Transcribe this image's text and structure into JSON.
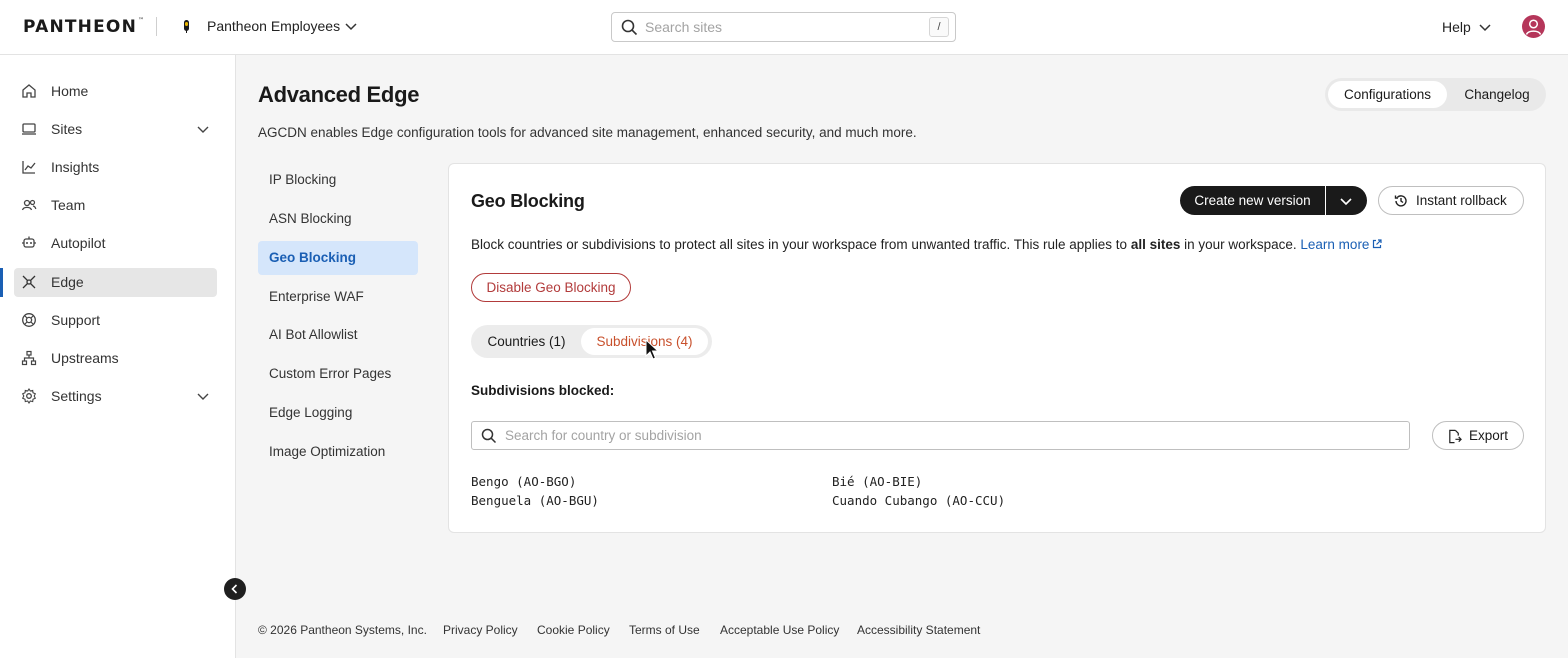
{
  "header": {
    "logo_text": "PANTHEON",
    "logo_mark": "™",
    "workspace_name": "Pantheon Employees",
    "search_placeholder": "Search sites",
    "search_shortcut": "/",
    "help_label": "Help",
    "colors": {
      "avatar": "#b5365a"
    }
  },
  "sidebar": {
    "items": [
      {
        "label": "Home",
        "icon": "home-icon"
      },
      {
        "label": "Sites",
        "icon": "sites-icon",
        "expandable": true
      },
      {
        "label": "Insights",
        "icon": "insights-icon"
      },
      {
        "label": "Team",
        "icon": "team-icon"
      },
      {
        "label": "Autopilot",
        "icon": "autopilot-icon"
      },
      {
        "label": "Edge",
        "icon": "edge-icon",
        "active": true
      },
      {
        "label": "Support",
        "icon": "support-icon"
      },
      {
        "label": "Upstreams",
        "icon": "upstreams-icon"
      },
      {
        "label": "Settings",
        "icon": "settings-icon",
        "expandable": true
      }
    ]
  },
  "main": {
    "title": "Advanced Edge",
    "description": "AGCDN enables Edge configuration tools for advanced site management, enhanced security, and much more.",
    "view_tabs": {
      "configurations": "Configurations",
      "changelog": "Changelog",
      "selected": "Configurations"
    },
    "subnav": [
      {
        "label": "IP Blocking"
      },
      {
        "label": "ASN Blocking"
      },
      {
        "label": "Geo Blocking",
        "active": true
      },
      {
        "label": "Enterprise WAF"
      },
      {
        "label": "AI Bot Allowlist"
      },
      {
        "label": "Custom Error Pages"
      },
      {
        "label": "Edge Logging"
      },
      {
        "label": "Image Optimization"
      }
    ]
  },
  "card": {
    "title": "Geo Blocking",
    "create_label": "Create new version",
    "rollback_label": "Instant rollback",
    "desc_part1": "Block countries or subdivisions to protect all sites in your workspace from unwanted traffic. This rule applies to ",
    "desc_bold": "all sites",
    "desc_part2": " in your workspace. ",
    "learn_more": "Learn more",
    "disable_label": "Disable Geo Blocking",
    "tabs": {
      "countries": "Countries (1)",
      "subdivisions": "Subdivisions (4)",
      "selected": "Subdivisions (4)"
    },
    "subdivisions_heading": "Subdivisions blocked:",
    "list_search_placeholder": "Search for country or subdivision",
    "export_label": "Export",
    "subdivisions": [
      "Bengo (AO-BGO)",
      "Benguela (AO-BGU)",
      "Bié (AO-BIE)",
      "Cuando Cubango (AO-CCU)"
    ],
    "colors": {
      "accent_tab": "#c8502c",
      "danger": "#b23b3b",
      "link": "#1a5fb4"
    }
  },
  "footer": {
    "copyright": "© 2026 Pantheon Systems, Inc.",
    "links": [
      "Privacy Policy",
      "Cookie Policy",
      "Terms of Use",
      "Acceptable Use Policy",
      "Accessibility Statement"
    ]
  }
}
